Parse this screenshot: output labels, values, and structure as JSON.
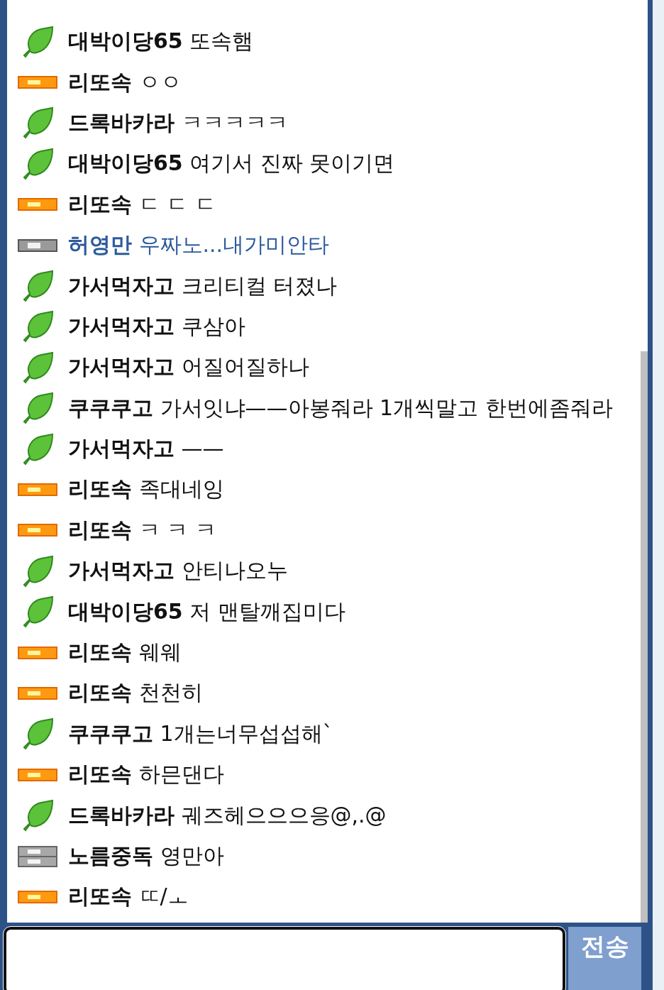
{
  "messages": [
    {
      "kind": "leaf",
      "name": "대박이당65",
      "text": "또속햄",
      "highlighted": false
    },
    {
      "kind": "orange",
      "name": "리또속",
      "text": "ㅇㅇ",
      "highlighted": false
    },
    {
      "kind": "leaf",
      "name": "드록바카라",
      "text": "ㅋㅋㅋㅋㅋ",
      "highlighted": false
    },
    {
      "kind": "leaf",
      "name": "대박이당65",
      "text": "여기서 진짜 못이기면",
      "highlighted": false
    },
    {
      "kind": "orange",
      "name": "리또속",
      "text": "ㄷ ㄷ ㄷ",
      "highlighted": false
    },
    {
      "kind": "gray",
      "name": "허영만",
      "text": "우짜노...내가미안타",
      "highlighted": true
    },
    {
      "kind": "leaf",
      "name": "가서먹자고",
      "text": "크리티컬 터졌나",
      "highlighted": false
    },
    {
      "kind": "leaf",
      "name": "가서먹자고",
      "text": "쿠삼아",
      "highlighted": false
    },
    {
      "kind": "leaf",
      "name": "가서먹자고",
      "text": "어질어질하나",
      "highlighted": false
    },
    {
      "kind": "leaf",
      "name": "쿠쿠쿠고",
      "text": "가서잇냐——아봉줘라 1개씩말고 한번에좀줘라",
      "highlighted": false
    },
    {
      "kind": "leaf",
      "name": "가서먹자고",
      "text": "——",
      "highlighted": false
    },
    {
      "kind": "orange",
      "name": "리또속",
      "text": "족대네잉",
      "highlighted": false
    },
    {
      "kind": "orange",
      "name": "리또속",
      "text": "ㅋ ㅋ ㅋ",
      "highlighted": false
    },
    {
      "kind": "leaf",
      "name": "가서먹자고",
      "text": "안티나오누",
      "highlighted": false
    },
    {
      "kind": "leaf",
      "name": "대박이당65",
      "text": "저 맨탈깨집미다",
      "highlighted": false
    },
    {
      "kind": "orange",
      "name": "리또속",
      "text": "웨웨",
      "highlighted": false
    },
    {
      "kind": "orange",
      "name": "리또속",
      "text": "천천히",
      "highlighted": false
    },
    {
      "kind": "leaf",
      "name": "쿠쿠쿠고",
      "text": "1개는너무섭섭해`",
      "highlighted": false
    },
    {
      "kind": "orange",
      "name": "리또속",
      "text": "하믄댄다",
      "highlighted": false
    },
    {
      "kind": "leaf",
      "name": "드록바카라",
      "text": "궤즈헤으으으응@,.@",
      "highlighted": false
    },
    {
      "kind": "silver",
      "name": "노름중독",
      "text": "영만아",
      "highlighted": false
    },
    {
      "kind": "orange",
      "name": "리또속",
      "text": "ㄸ/ㅗ",
      "highlighted": false
    }
  ],
  "send_button": "전송"
}
